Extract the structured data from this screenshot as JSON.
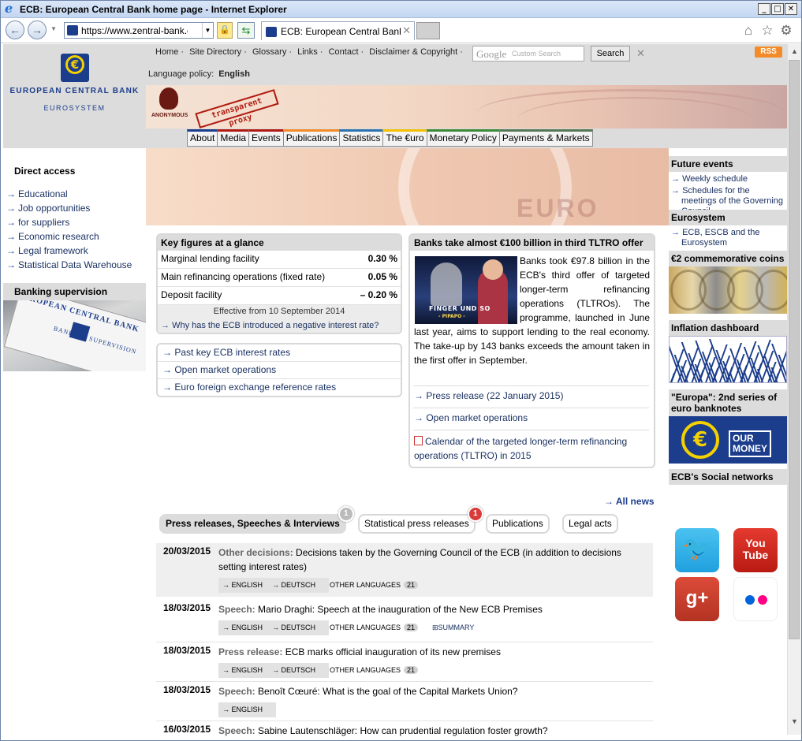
{
  "browser": {
    "title": "ECB: European Central Bank home page - Internet Explorer",
    "url": "https://www.zentral-bank.c",
    "tab_label": "ECB: European Central Bank ...",
    "window_buttons": {
      "min": "_",
      "max": "□",
      "close": "✕"
    }
  },
  "header": {
    "logo_line1": "EUROPEAN CENTRAL BANK",
    "logo_line2": "EUROSYSTEM",
    "top_links": [
      "Home ·",
      "Site Directory ·",
      "Glossary ·",
      "Links ·",
      "Contact ·",
      "Disclaimer & Copyright ·"
    ],
    "search_placeholder": "Google",
    "search_custom": "Custom Search",
    "search_button": "Search",
    "search_clear": "✕",
    "rss": "RSS",
    "language_policy_label": "Language policy:",
    "language_policy_value": "English",
    "anon_label": "ANONYMOUS",
    "proxy_stamp": "transparent proxy"
  },
  "menu": [
    "About",
    "Media",
    "Events",
    "Publications",
    "Statistics",
    "The €uro",
    "Monetary Policy",
    "Payments & Markets"
  ],
  "banner_text": "EURO",
  "sidebar": {
    "direct_access_title": "Direct access",
    "links": [
      "Educational",
      "Job opportunities",
      "for suppliers",
      "Economic research",
      "Legal framework",
      "Statistical Data Warehouse"
    ],
    "banking_supervision_title": "Banking supervision",
    "sign_line1": "EUROPEAN CENTRAL BANK",
    "sign_line2": "BANKING SUPERVISION"
  },
  "key_figures": {
    "title": "Key figures at a glance",
    "rows": [
      {
        "label": "Marginal lending facility",
        "value": "0.30 %"
      },
      {
        "label": "Main refinancing operations (fixed rate)",
        "value": "0.05 %"
      },
      {
        "label": "Deposit facility",
        "value": "– 0.20 %"
      }
    ],
    "effective": "Effective from 10 September 2014",
    "why_link": "Why has the ECB introduced a negative interest rate?",
    "links": [
      "Past key ECB interest rates",
      "Open market operations",
      "Euro foreign exchange reference rates"
    ]
  },
  "news": {
    "title": "Banks take almost €100 billion in third TLTRO offer",
    "thumb_caption": "FINGER UND SO",
    "thumb_caption2": "- PIPAPO -",
    "body": "Banks took €97.8 billion in the ECB's third offer of targeted longer-term refinancing operations (TLTROs). The programme, launched in June last year, aims to support lending to the real economy. The take-up by 143 banks exceeds the amount taken in the first offer in September.",
    "links": [
      "Press release (22 January 2015)",
      "Open market operations",
      "Calendar of the targeted longer-term refinancing operations (TLTRO) in 2015"
    ]
  },
  "right_column": {
    "future_events": "Future events",
    "future_links": [
      "Weekly schedule",
      "Schedules for the meetings of the Governing Council"
    ],
    "eurosystem": "Eurosystem",
    "eurosystem_links": [
      "ECB, ESCB and the Eurosystem"
    ],
    "coins": "€2 commemorative coins",
    "inflation": "Inflation dashboard",
    "europa": "\"Europa\": 2nd series of euro banknotes",
    "our_money_line1": "OUR",
    "our_money_line2": "MONEY",
    "social": "ECB's Social networks",
    "youtube_line1": "You",
    "youtube_line2": "Tube",
    "gplus": "g+"
  },
  "press": {
    "all_news": "All news",
    "tabs": [
      {
        "label": "Press releases, Speeches & Interviews",
        "badge": "1"
      },
      {
        "label": "Statistical press releases",
        "badge": "1"
      },
      {
        "label": "Publications"
      },
      {
        "label": "Legal acts"
      }
    ],
    "other_languages": "OTHER LANGUAGES",
    "summary": "SUMMARY",
    "items": [
      {
        "date": "20/03/2015",
        "type": "Other decisions:",
        "title": "Decisions taken by the Governing Council of the ECB (in addition to decisions setting interest rates)",
        "langs": [
          "ENGLISH",
          "DEUTSCH"
        ],
        "count": "21"
      },
      {
        "date": "18/03/2015",
        "type": "Speech:",
        "title": "Mario Draghi:  Speech at the inauguration of the New ECB Premises",
        "langs": [
          "ENGLISH",
          "DEUTSCH"
        ],
        "count": "21"
      },
      {
        "date": "18/03/2015",
        "type": "Press release:",
        "title": "ECB marks official inauguration of its new premises",
        "langs": [
          "ENGLISH",
          "DEUTSCH"
        ],
        "count": "21"
      },
      {
        "date": "18/03/2015",
        "type": "Speech:",
        "title": "Benoît Cœuré:  What is the goal of the Capital Markets Union?",
        "langs": [
          "ENGLISH"
        ]
      },
      {
        "date": "16/03/2015",
        "type": "Speech:",
        "title": "Sabine Lautenschläger:  How can prudential regulation foster growth?"
      }
    ]
  }
}
